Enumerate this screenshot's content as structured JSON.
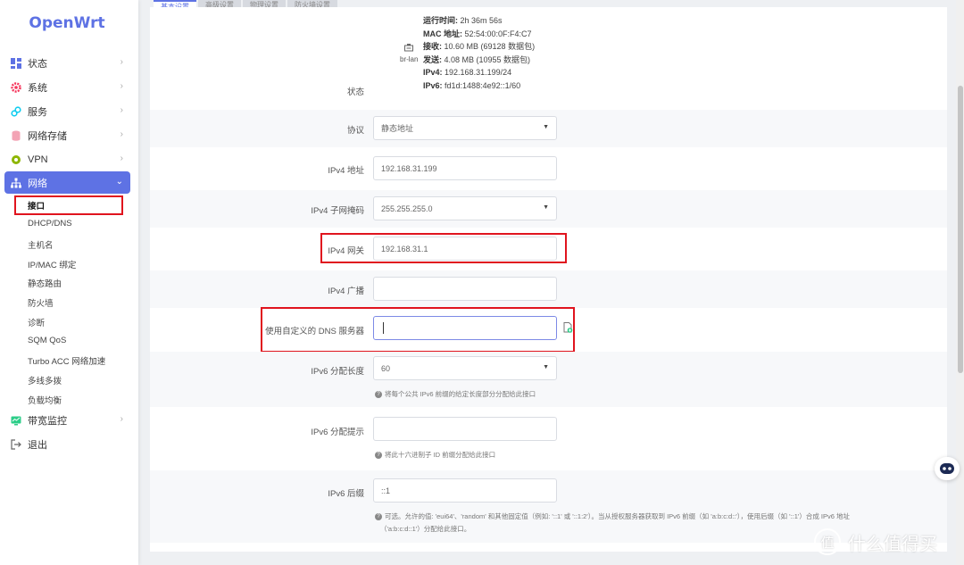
{
  "app": {
    "title": "OpenWrt"
  },
  "sidebar": {
    "items": [
      {
        "label": "状态",
        "icon": "dashboard-icon",
        "color": "#5e72e4"
      },
      {
        "label": "系统",
        "icon": "gear-icon",
        "color": "#f5365c"
      },
      {
        "label": "服务",
        "icon": "link-icon",
        "color": "#11cdef"
      },
      {
        "label": "网络存储",
        "icon": "database-icon",
        "color": "#f3a4b5"
      },
      {
        "label": "VPN",
        "icon": "shield-icon",
        "color": "#8db600"
      },
      {
        "label": "网络",
        "icon": "network-icon",
        "color": "#ffffff"
      }
    ],
    "sub_items": [
      "接口",
      "DHCP/DNS",
      "主机名",
      "IP/MAC 绑定",
      "静态路由",
      "防火墙",
      "诊断",
      "SQM QoS",
      "Turbo ACC 网络加速",
      "多线多拨",
      "负载均衡"
    ],
    "bottom_items": [
      {
        "label": "带宽监控",
        "icon": "monitor-icon",
        "color": "#2dce89"
      },
      {
        "label": "退出",
        "icon": "logout-icon",
        "color": "#666666"
      }
    ]
  },
  "tabs": [
    "基本设置",
    "高级设置",
    "物理设置",
    "防火墙设置"
  ],
  "status": {
    "label": "状态",
    "device": "br-lan",
    "uptime_key": "运行时间:",
    "uptime": "2h 36m 56s",
    "mac_key": "MAC 地址:",
    "mac": "52:54:00:0F:F4:C7",
    "rx_key": "接收:",
    "rx": "10.60 MB (69128 数据包)",
    "tx_key": "发送:",
    "tx": "4.08 MB (10955 数据包)",
    "ipv4_key": "IPv4:",
    "ipv4": "192.168.31.199/24",
    "ipv6_key": "IPv6:",
    "ipv6": "fd1d:1488:4e92::1/60"
  },
  "form": {
    "protocol": {
      "label": "协议",
      "value": "静态地址"
    },
    "ipv4_addr": {
      "label": "IPv4 地址",
      "value": "192.168.31.199"
    },
    "netmask": {
      "label": "IPv4 子网掩码",
      "value": "255.255.255.0"
    },
    "gateway": {
      "label": "IPv4 网关",
      "value": "192.168.31.1"
    },
    "broadcast": {
      "label": "IPv4 广播",
      "value": ""
    },
    "dns": {
      "label": "使用自定义的 DNS 服务器",
      "value": ""
    },
    "ip6assign": {
      "label": "IPv6 分配长度",
      "value": "60",
      "hint": "将每个公共 IPv6 前缀的给定长度部分分配给此接口"
    },
    "ip6hint": {
      "label": "IPv6 分配提示",
      "value": "",
      "hint": "将此十六进制子 ID 前缀分配给此接口"
    },
    "ip6suffix": {
      "label": "IPv6 后缀",
      "value": "::1",
      "hint1": "可选。允许的值: 'eui64'、'random' 和其他固定值（例如: '::1' 或 '::1:2'）。当从授权服务器获取到 IPv6 前缀（如 'a:b:c:d::'），使用后缀（如 '::1'）合成 IPv6 地址",
      "hint2": "（'a:b:c:d::1'）分配给此接口。"
    }
  },
  "watermark": "什么值得买"
}
